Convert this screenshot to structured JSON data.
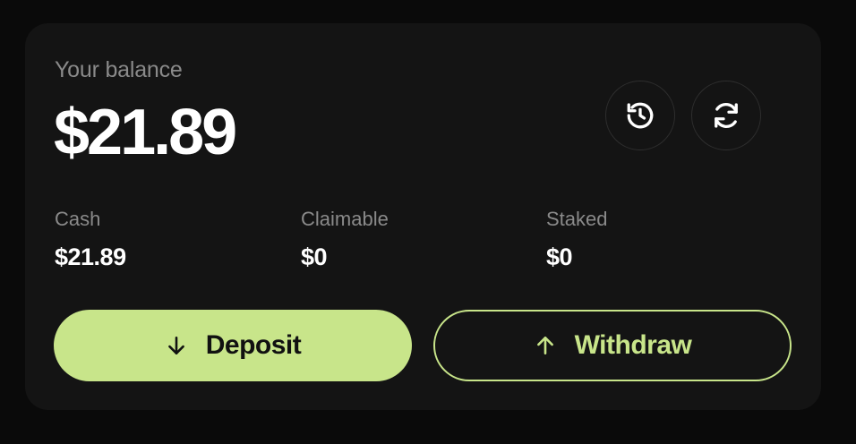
{
  "balance_card": {
    "title": "Your balance",
    "total": "$21.89",
    "icons": {
      "history": "history-icon",
      "refresh": "refresh-icon"
    }
  },
  "stats": [
    {
      "label": "Cash",
      "value": "$21.89"
    },
    {
      "label": "Claimable",
      "value": "$0"
    },
    {
      "label": "Staked",
      "value": "$0"
    }
  ],
  "actions": {
    "deposit_label": "Deposit",
    "withdraw_label": "Withdraw"
  },
  "colors": {
    "accent": "#c8e58a",
    "card_bg": "#141414",
    "page_bg": "#0a0a0a",
    "muted_text": "#8a8a8a"
  }
}
